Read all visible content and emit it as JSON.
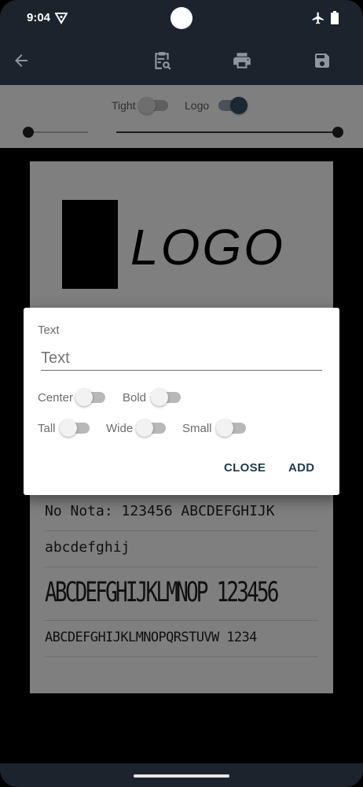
{
  "status_bar": {
    "time": "9:04",
    "vpn_icon": "vpn-key-icon",
    "airplane_icon": "airplane-icon",
    "battery_icon": "battery-icon"
  },
  "app_bar": {
    "back_icon": "arrow-back-icon",
    "preview_icon": "clipboard-search-icon",
    "print_icon": "printer-icon",
    "save_icon": "floppy-disk-icon",
    "background_color": "#1c232d"
  },
  "options": {
    "tight_label": "Tight",
    "tight_on": false,
    "logo_label": "Logo",
    "logo_on": true,
    "slider_left_value": 0,
    "slider_right_value": 1
  },
  "receipt": {
    "logo_text": "LOGO",
    "lines": [
      "No Nota: 123456   ABCDEFGHIJK",
      "abcdefghij",
      "ABCDEFGHIJKLMNOP       123456",
      "ABCDEFGHIJKLMNOPQRSTUVW  1234"
    ]
  },
  "dialog": {
    "title": "Text",
    "input_value": "",
    "input_placeholder": "Text",
    "toggles": [
      {
        "label": "Center",
        "on": false
      },
      {
        "label": "Bold",
        "on": false
      },
      {
        "label": "Tall",
        "on": false
      },
      {
        "label": "Wide",
        "on": false
      },
      {
        "label": "Small",
        "on": false
      }
    ],
    "close_label": "CLOSE",
    "add_label": "ADD"
  }
}
